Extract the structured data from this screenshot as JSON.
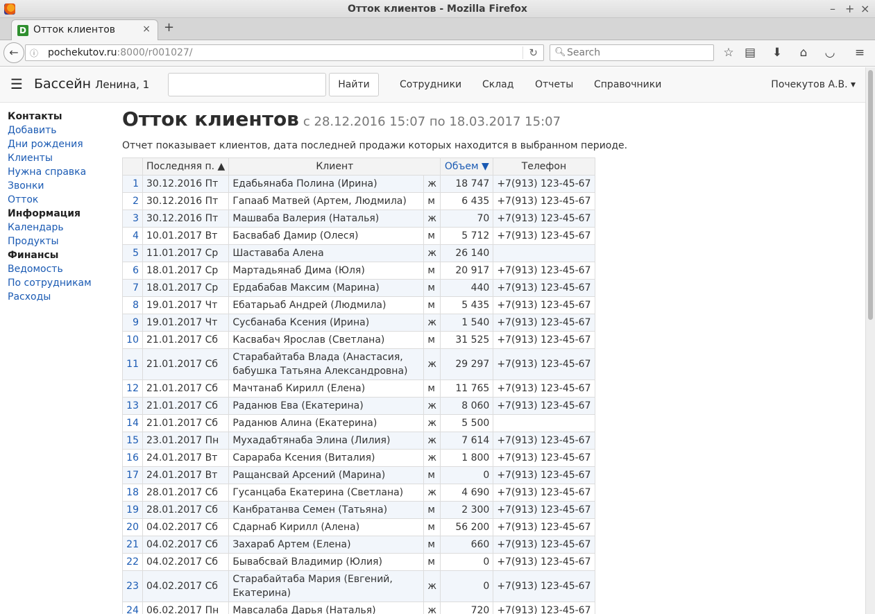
{
  "window": {
    "title": "Отток клиентов - Mozilla Firefox"
  },
  "tab": {
    "favicon_letter": "D",
    "title": "Отток клиентов"
  },
  "browser": {
    "url_host": "pochekutov.ru",
    "url_rest": ":8000/r001027/",
    "search_placeholder": "Search"
  },
  "app": {
    "brand": "Бассейн",
    "brand_addr": "Ленина, 1",
    "find_button": "Найти",
    "menu": [
      "Сотрудники",
      "Склад",
      "Отчеты",
      "Справочники"
    ],
    "user": "Почекутов А.В. ▾"
  },
  "sidebar": [
    {
      "label": "Контакты",
      "type": "head"
    },
    {
      "label": "Добавить",
      "type": "link"
    },
    {
      "label": "Дни рождения",
      "type": "link"
    },
    {
      "label": "Клиенты",
      "type": "link"
    },
    {
      "label": "Нужна справка",
      "type": "link"
    },
    {
      "label": "Звонки",
      "type": "link"
    },
    {
      "label": "Отток",
      "type": "link"
    },
    {
      "label": "Информация",
      "type": "head"
    },
    {
      "label": "Календарь",
      "type": "link"
    },
    {
      "label": "Продукты",
      "type": "link"
    },
    {
      "label": "Финансы",
      "type": "head"
    },
    {
      "label": "Ведомость",
      "type": "link"
    },
    {
      "label": "По сотрудникам",
      "type": "link"
    },
    {
      "label": "Расходы",
      "type": "link"
    }
  ],
  "report": {
    "title": "Отток клиентов",
    "period": "с 28.12.2016 15:07 по 18.03.2017 15:07",
    "description": "Отчет показывает клиентов, дата последней продажи которых находится в выбранном периоде.",
    "columns": {
      "num": "",
      "last": "Последняя п. ▲",
      "client": "Клиент",
      "volume": "Объем ▼",
      "phone": "Телефон"
    },
    "rows": [
      {
        "n": "1",
        "date": "30.12.2016 Пт",
        "client": "Едабьянаба Полина (Ирина)",
        "sex": "ж",
        "volume": "18 747",
        "phone": "+7(913) 123-45-67"
      },
      {
        "n": "2",
        "date": "30.12.2016 Пт",
        "client": "Гапааб Матвей (Артем, Людмила)",
        "sex": "м",
        "volume": "6 435",
        "phone": "+7(913) 123-45-67"
      },
      {
        "n": "3",
        "date": "30.12.2016 Пт",
        "client": "Машваба Валерия (Наталья)",
        "sex": "ж",
        "volume": "70",
        "phone": "+7(913) 123-45-67"
      },
      {
        "n": "4",
        "date": "10.01.2017 Вт",
        "client": "Басвабаб Дамир (Олеся)",
        "sex": "м",
        "volume": "5 712",
        "phone": "+7(913) 123-45-67"
      },
      {
        "n": "5",
        "date": "11.01.2017 Ср",
        "client": "Шаставаба Алена",
        "sex": "ж",
        "volume": "26 140",
        "phone": ""
      },
      {
        "n": "6",
        "date": "18.01.2017 Ср",
        "client": "Мартадьянаб Дима (Юля)",
        "sex": "м",
        "volume": "20 917",
        "phone": "+7(913) 123-45-67"
      },
      {
        "n": "7",
        "date": "18.01.2017 Ср",
        "client": "Ердабабав Максим (Марина)",
        "sex": "м",
        "volume": "440",
        "phone": "+7(913) 123-45-67"
      },
      {
        "n": "8",
        "date": "19.01.2017 Чт",
        "client": "Ебатарьаб Андрей (Людмила)",
        "sex": "м",
        "volume": "5 435",
        "phone": "+7(913) 123-45-67"
      },
      {
        "n": "9",
        "date": "19.01.2017 Чт",
        "client": "Сусбанаба Ксения (Ирина)",
        "sex": "ж",
        "volume": "1 540",
        "phone": "+7(913) 123-45-67"
      },
      {
        "n": "10",
        "date": "21.01.2017 Сб",
        "client": "Касвабач Ярослав (Светлана)",
        "sex": "м",
        "volume": "31 525",
        "phone": "+7(913) 123-45-67"
      },
      {
        "n": "11",
        "date": "21.01.2017 Сб",
        "client": "Старабайтаба Влада (Анастасия, бабушка Татьяна Александровна)",
        "sex": "ж",
        "volume": "29 297",
        "phone": "+7(913) 123-45-67",
        "tall": true
      },
      {
        "n": "12",
        "date": "21.01.2017 Сб",
        "client": "Мачтанаб Кирилл (Елена)",
        "sex": "м",
        "volume": "11 765",
        "phone": "+7(913) 123-45-67"
      },
      {
        "n": "13",
        "date": "21.01.2017 Сб",
        "client": "Раданюв Ева (Екатерина)",
        "sex": "ж",
        "volume": "8 060",
        "phone": "+7(913) 123-45-67"
      },
      {
        "n": "14",
        "date": "21.01.2017 Сб",
        "client": "Раданюв Алина (Екатерина)",
        "sex": "ж",
        "volume": "5 500",
        "phone": ""
      },
      {
        "n": "15",
        "date": "23.01.2017 Пн",
        "client": "Мухадабтянаба Элина (Лилия)",
        "sex": "ж",
        "volume": "7 614",
        "phone": "+7(913) 123-45-67"
      },
      {
        "n": "16",
        "date": "24.01.2017 Вт",
        "client": "Сарараба Ксения (Виталия)",
        "sex": "ж",
        "volume": "1 800",
        "phone": "+7(913) 123-45-67"
      },
      {
        "n": "17",
        "date": "24.01.2017 Вт",
        "client": "Ращансвай Арсений (Марина)",
        "sex": "м",
        "volume": "0",
        "phone": "+7(913) 123-45-67"
      },
      {
        "n": "18",
        "date": "28.01.2017 Сб",
        "client": "Гусанцаба Екатерина (Светлана)",
        "sex": "ж",
        "volume": "4 690",
        "phone": "+7(913) 123-45-67"
      },
      {
        "n": "19",
        "date": "28.01.2017 Сб",
        "client": "Канбратанва Семен (Татьяна)",
        "sex": "м",
        "volume": "2 300",
        "phone": "+7(913) 123-45-67"
      },
      {
        "n": "20",
        "date": "04.02.2017 Сб",
        "client": "Сдарнаб Кирилл (Алена)",
        "sex": "м",
        "volume": "56 200",
        "phone": "+7(913) 123-45-67"
      },
      {
        "n": "21",
        "date": "04.02.2017 Сб",
        "client": "Захараб Артем (Елена)",
        "sex": "м",
        "volume": "660",
        "phone": "+7(913) 123-45-67"
      },
      {
        "n": "22",
        "date": "04.02.2017 Сб",
        "client": "Бывабсвай Владимир (Юлия)",
        "sex": "м",
        "volume": "0",
        "phone": "+7(913) 123-45-67"
      },
      {
        "n": "23",
        "date": "04.02.2017 Сб",
        "client": "Старабайтаба Мария (Евгений, Екатерина)",
        "sex": "ж",
        "volume": "0",
        "phone": "+7(913) 123-45-67",
        "tall": true
      },
      {
        "n": "24",
        "date": "06.02.2017 Пн",
        "client": "Мавсалаба Дарья (Наталья)",
        "sex": "ж",
        "volume": "720",
        "phone": "+7(913) 123-45-67"
      }
    ]
  }
}
